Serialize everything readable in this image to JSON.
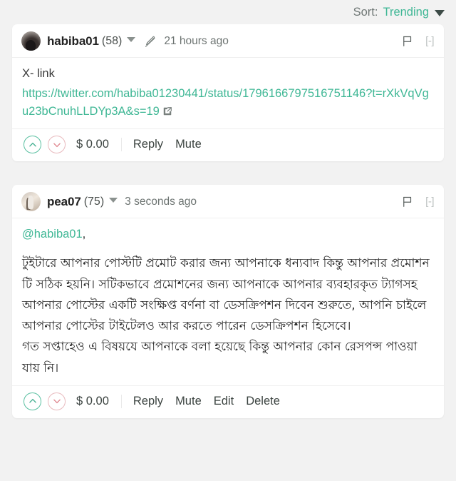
{
  "sort": {
    "label": "Sort:",
    "value": "Trending",
    "caret_icon": "chevron-down-icon"
  },
  "colors": {
    "accent_green": "#3fb795",
    "upvote_border": "#58bfa0",
    "downvote_border": "#e8b9bd",
    "page_background": "#f2f2f2",
    "card_background": "#ffffff"
  },
  "comments": [
    {
      "username": "habiba01",
      "reputation": "(58)",
      "timestamp": "21 hours ago",
      "edited_icon": "pencil-icon",
      "flag_icon": "flag-icon",
      "collapse_toggle": "[-]",
      "body_title": "X- link",
      "body_link": "https://twitter.com/habiba01230441/status/1796166797516751146?t=rXkVqVgu23bCnuhLLDYp3A&s=19",
      "external_link_icon": "external-link-icon",
      "payout": "$ 0.00",
      "actions": [
        "Reply",
        "Mute"
      ]
    },
    {
      "username": "pea07",
      "reputation": "(75)",
      "timestamp": "3 seconds ago",
      "flag_icon": "flag-icon",
      "collapse_toggle": "[-]",
      "mention": "@habiba01",
      "mention_suffix": ",",
      "paragraphs": [
        "টুইটারে আপনার পোস্টটি প্রমোট করার জন্য আপনাকে ধন্যবাদ কিন্তু আপনার প্রমোশন টি সঠিক হয়নি। সটিকভাবে প্রমোশনের জন্য আপনাকে আপনার ব্যবহারকৃত ট্যাগসহ আপনার পোস্টের একটি সংক্ষিপ্ত বর্ণনা বা ডেসক্রিপশন দিবেন শুরুতে, আপনি চাইলে আপনার পোস্টের টাইটেলও আর করতে পারেন ডেসক্রিপশন হিসেবে।",
        "গত সপ্তাহেও এ বিষয়যে আপনাকে বলা হয়েছে কিন্তু আপনার কোন রেসপন্স পাওয়া যায় নি।"
      ],
      "payout": "$ 0.00",
      "actions": [
        "Reply",
        "Mute",
        "Edit",
        "Delete"
      ]
    }
  ]
}
